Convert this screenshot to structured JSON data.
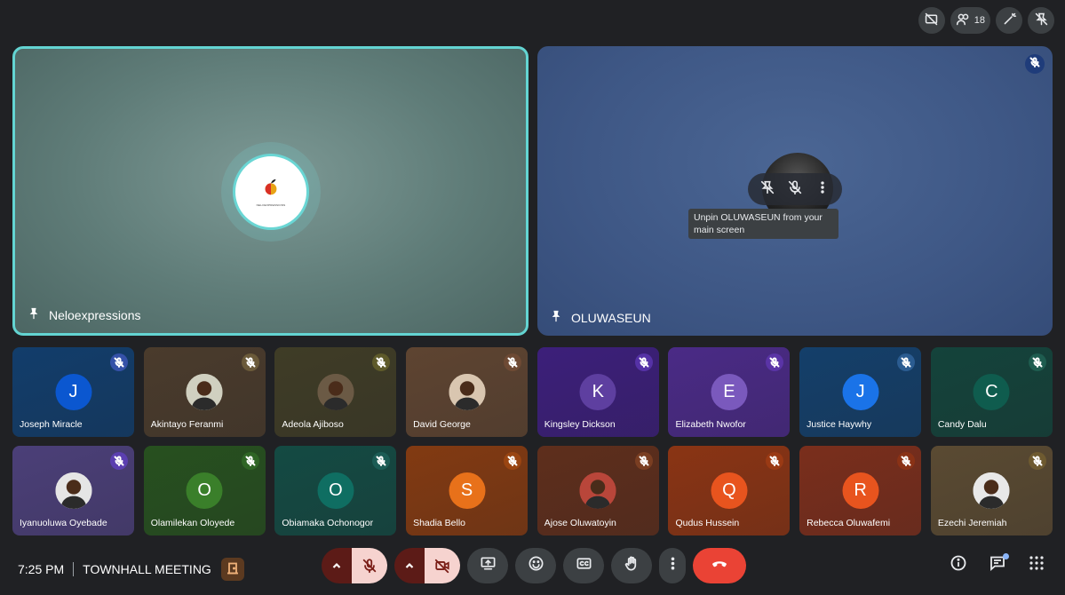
{
  "top_bar": {
    "participant_count": "18"
  },
  "main": {
    "left": {
      "name": "Neloexpressions",
      "logo_text": "NELOEXPRESSIONS"
    },
    "right": {
      "name": "OLUWASEUN",
      "tooltip": "Unpin OLUWASEUN from your main screen"
    }
  },
  "participants": [
    {
      "name": "Joseph Miracle",
      "initial": "J",
      "bg": "#123d6b",
      "avatar": "#0b57d0",
      "mic": "#3551a8"
    },
    {
      "name": "Akintayo Feranmi",
      "initial": "",
      "bg": "#4a3b2c",
      "avatar": "#d0d0c0",
      "mic": "#6b5a3a"
    },
    {
      "name": "Adeola Ajiboso",
      "initial": "",
      "bg": "#3f3c26",
      "avatar": "#6b5a45",
      "mic": "#5e5a2a"
    },
    {
      "name": "David George",
      "initial": "",
      "bg": "#5e4431",
      "avatar": "#d9c6b0",
      "mic": "#6e4a34"
    },
    {
      "name": "Kingsley Dickson",
      "initial": "K",
      "bg": "#3c1f7a",
      "avatar": "#5e3fa0",
      "mic": "#5532a6"
    },
    {
      "name": "Elizabeth Nwofor",
      "initial": "E",
      "bg": "#4a2a86",
      "avatar": "#7a59bd",
      "mic": "#5a34a6"
    },
    {
      "name": "Justice Haywhy",
      "initial": "J",
      "bg": "#143f6a",
      "avatar": "#1a73e8",
      "mic": "#2b5c91"
    },
    {
      "name": "Candy Dalu",
      "initial": "C",
      "bg": "#14433b",
      "avatar": "#0f5c4e",
      "mic": "#1e5c4f"
    },
    {
      "name": "Iyanuoluwa Oyebade",
      "initial": "",
      "bg": "#4b3f78",
      "avatar": "#e5e5e5",
      "mic": "#5b3fb0"
    },
    {
      "name": "Olamilekan Oloyede",
      "initial": "O",
      "bg": "#27501f",
      "avatar": "#3a7f2a",
      "mic": "#2f6525"
    },
    {
      "name": "Obiamaka Ochonogor",
      "initial": "O",
      "bg": "#144a43",
      "avatar": "#0f6e62",
      "mic": "#1c5c55"
    },
    {
      "name": "Shadia Bello",
      "initial": "S",
      "bg": "#823a12",
      "avatar": "#e8711a",
      "mic": "#9a4512"
    },
    {
      "name": "Ajose Oluwatoyin",
      "initial": "",
      "bg": "#5e2e1c",
      "avatar": "#b9463a",
      "mic": "#7a3e22"
    },
    {
      "name": "Qudus Hussein",
      "initial": "Q",
      "bg": "#8a3414",
      "avatar": "#e8541e",
      "mic": "#9a3a14"
    },
    {
      "name": "Rebecca Oluwafemi",
      "initial": "R",
      "bg": "#7a2e1c",
      "avatar": "#e8541e",
      "mic": "#8a3216"
    },
    {
      "name": "Ezechi Jeremiah",
      "initial": "",
      "bg": "#5a4a32",
      "avatar": "#e8e8e8",
      "mic": "#6e5a30"
    }
  ],
  "bottom_bar": {
    "time": "7:25 PM",
    "meeting_title": "TOWNHALL MEETING"
  },
  "colors": {
    "background": "#202124",
    "active_speaker_border": "#63d4d2",
    "end_call": "#ea4335",
    "muted_control_bg": "#f6d3cf"
  }
}
